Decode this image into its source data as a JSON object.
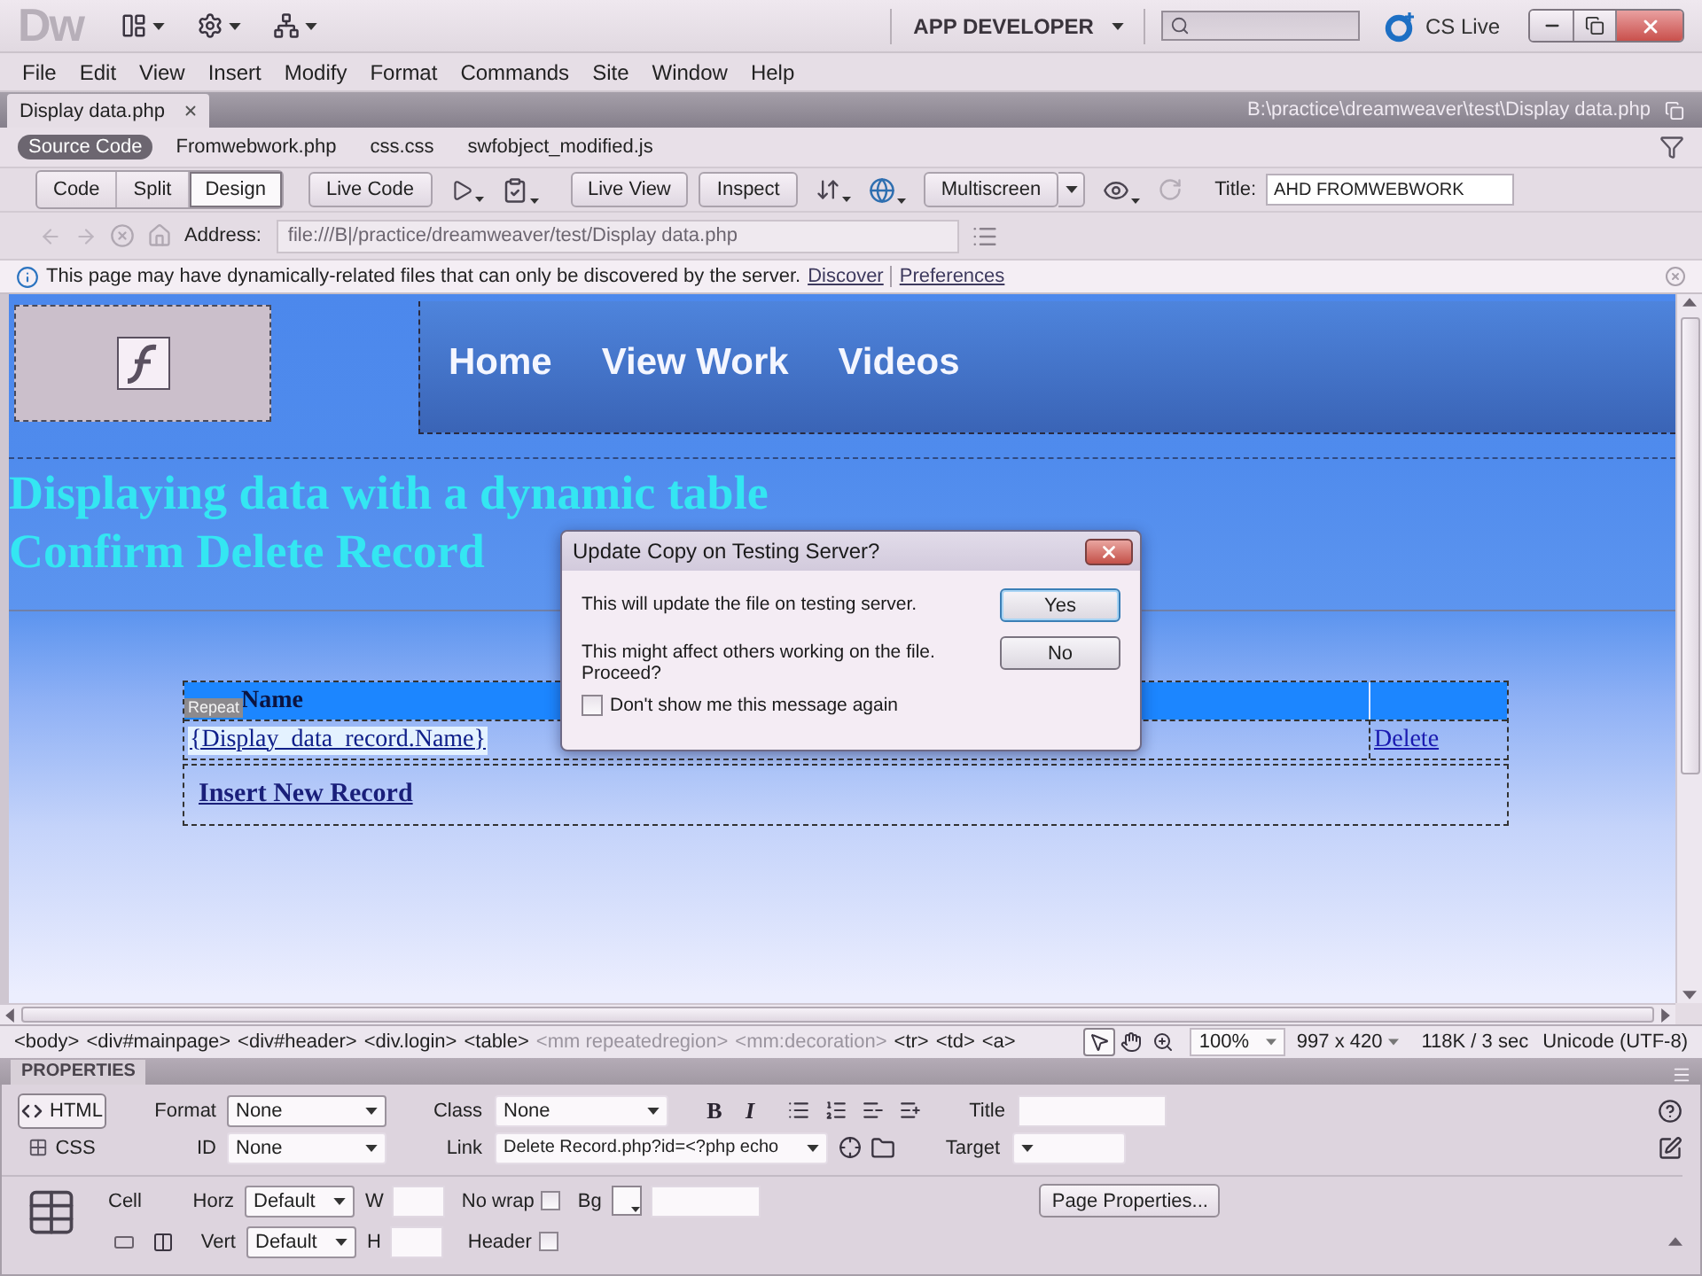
{
  "app_bar": {
    "logo": "Dw",
    "workspace": "APP DEVELOPER",
    "cs_live": "CS Live"
  },
  "menu": [
    "File",
    "Edit",
    "View",
    "Insert",
    "Modify",
    "Format",
    "Commands",
    "Site",
    "Window",
    "Help"
  ],
  "document_tabs": [
    {
      "label": "Display data.php",
      "selected": true
    }
  ],
  "file_path": "B:\\practice\\dreamweaver\\test\\Display data.php",
  "related_files": [
    {
      "label": "Source Code",
      "selected": true
    },
    {
      "label": "Fromwebwork.php",
      "selected": false
    },
    {
      "label": "css.css",
      "selected": false
    },
    {
      "label": "swfobject_modified.js",
      "selected": false
    }
  ],
  "document_toolbar": {
    "views": [
      {
        "label": "Code",
        "selected": false
      },
      {
        "label": "Split",
        "selected": false
      },
      {
        "label": "Design",
        "selected": true
      }
    ],
    "live_code": "Live Code",
    "live_view": "Live View",
    "inspect": "Inspect",
    "multiscreen": "Multiscreen",
    "title_label": "Title:",
    "title_value": "AHD FROMWEBWORK"
  },
  "address_bar": {
    "label": "Address:",
    "value": "file:///B|/practice/dreamweaver/test/Display data.php"
  },
  "info_bar": {
    "message": "This page may have dynamically-related files that can only be discovered by the server.",
    "links": [
      "Discover",
      "Preferences"
    ]
  },
  "design_view": {
    "nav": [
      "Home",
      "View Work",
      "Videos"
    ],
    "headings": [
      "Displaying data with a dynamic table",
      "Confirm Delete Record"
    ],
    "table": {
      "header": "Name",
      "repeat_tag": "Repeat",
      "rows": [
        {
          "name": "{Display_data_record.Name}",
          "action": "Delete"
        }
      ]
    },
    "insert_link": "Insert New Record"
  },
  "dialog": {
    "title": "Update Copy on Testing Server?",
    "messages": [
      "This will update the file on testing server.",
      "This might affect others working on the file. Proceed?"
    ],
    "buttons": [
      {
        "label": "Yes",
        "selected": true
      },
      {
        "label": "No",
        "selected": false
      }
    ],
    "checkbox": {
      "label": "Don't show me this message again",
      "checked": false
    }
  },
  "tag_selector": [
    {
      "label": "<body>",
      "disabled": false
    },
    {
      "label": "<div#mainpage>",
      "disabled": false
    },
    {
      "label": "<div#header>",
      "disabled": false
    },
    {
      "label": "<div.login>",
      "disabled": false
    },
    {
      "label": "<table>",
      "disabled": false
    },
    {
      "label": "<mm repeatedregion>",
      "disabled": true
    },
    {
      "label": "<mm:decoration>",
      "disabled": true
    },
    {
      "label": "<tr>",
      "disabled": false
    },
    {
      "label": "<td>",
      "disabled": false
    },
    {
      "label": "<a>",
      "disabled": false
    }
  ],
  "status_bar": {
    "tools": [
      {
        "kind": "pointer",
        "selected": true
      },
      {
        "kind": "hand",
        "selected": false
      },
      {
        "kind": "zoom",
        "selected": false
      }
    ],
    "zoom": "100%",
    "window_size": "997 x 420",
    "download": "118K / 3 sec",
    "encoding": "Unicode (UTF-8)"
  },
  "properties": {
    "title": "PROPERTIES",
    "modes": [
      {
        "label": "HTML",
        "selected": true
      },
      {
        "label": "CSS",
        "selected": false
      }
    ],
    "format": {
      "label": "Format",
      "value": "None"
    },
    "class": {
      "label": "Class",
      "value": "None"
    },
    "bold": "B",
    "italic": "I",
    "title_field": {
      "label": "Title"
    },
    "id": {
      "label": "ID",
      "value": "None"
    },
    "link": {
      "label": "Link",
      "value": "Delete Record.php?id=<?php echo"
    },
    "target": {
      "label": "Target"
    },
    "cell_label": "Cell",
    "horz": {
      "label": "Horz",
      "value": "Default"
    },
    "width": {
      "label": "W"
    },
    "no_wrap": {
      "label": "No wrap",
      "checked": false
    },
    "bg": {
      "label": "Bg"
    },
    "page_properties": "Page Properties...",
    "vert": {
      "label": "Vert",
      "value": "Default"
    },
    "height": {
      "label": "H"
    },
    "header_cell": {
      "label": "Header",
      "checked": false
    }
  }
}
